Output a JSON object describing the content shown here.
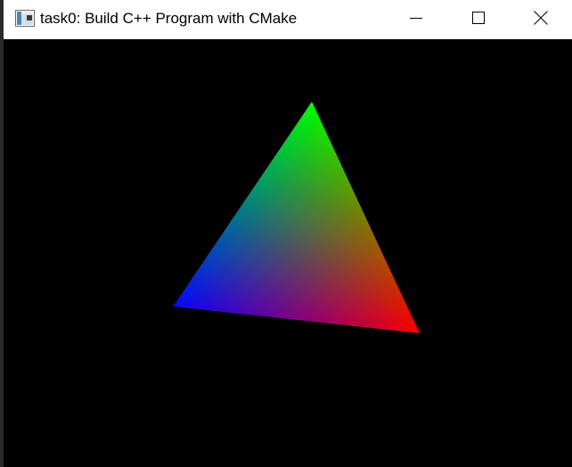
{
  "window": {
    "title": "task0: Build C++ Program with CMake",
    "app_icon": "window-icon",
    "controls": {
      "minimize": "minimize-icon",
      "maximize": "maximize-icon",
      "close": "close-icon"
    }
  },
  "viewport": {
    "background": "#000000",
    "triangle": {
      "vertex_colors": {
        "top": "#00ff00",
        "left": "#0000ff",
        "right": "#ff0000"
      }
    }
  }
}
